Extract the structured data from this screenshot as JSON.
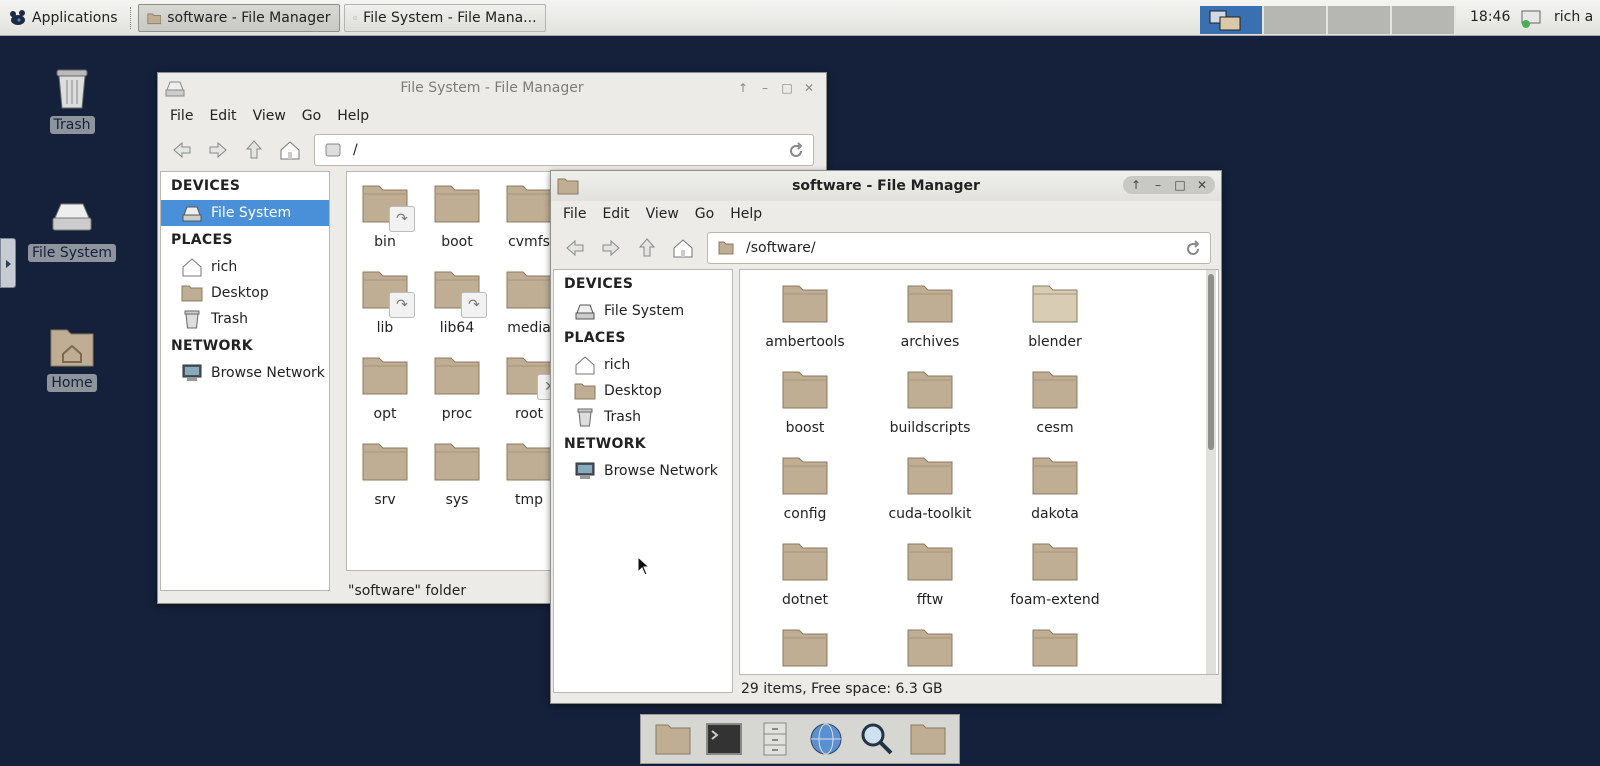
{
  "panel": {
    "apps_label": "Applications",
    "tasks": [
      {
        "label": "software - File Manager"
      },
      {
        "label": "File System - File Mana..."
      }
    ],
    "clock": "18:46",
    "user": "rich a"
  },
  "desktop": {
    "icons": [
      {
        "label": "Trash"
      },
      {
        "label": "File System"
      },
      {
        "label": "Home"
      }
    ]
  },
  "window_back": {
    "title": "File System - File Manager",
    "menu": [
      "File",
      "Edit",
      "View",
      "Go",
      "Help"
    ],
    "location": "/",
    "sidebar": {
      "devices_head": "DEVICES",
      "devices": [
        "File System"
      ],
      "places_head": "PLACES",
      "places": [
        "rich",
        "Desktop",
        "Trash"
      ],
      "network_head": "NETWORK",
      "network": [
        "Browse Network"
      ]
    },
    "folders": [
      "bin",
      "boot",
      "cvmfs",
      "lib",
      "lib64",
      "media",
      "opt",
      "proc",
      "root",
      "srv",
      "sys",
      "tmp"
    ],
    "status": "\"software\" folder"
  },
  "window_front": {
    "title": "software - File Manager",
    "menu": [
      "File",
      "Edit",
      "View",
      "Go",
      "Help"
    ],
    "location": "/software/",
    "sidebar": {
      "devices_head": "DEVICES",
      "devices": [
        "File System"
      ],
      "places_head": "PLACES",
      "places": [
        "rich",
        "Desktop",
        "Trash"
      ],
      "network_head": "NETWORK",
      "network": [
        "Browse Network"
      ]
    },
    "folders": [
      "ambertools",
      "archives",
      "blender",
      "boost",
      "buildscripts",
      "cesm",
      "config",
      "cuda-toolkit",
      "dakota",
      "dotnet",
      "fftw",
      "foam-extend",
      "",
      "",
      ""
    ],
    "status": "29 items, Free space: 6.3 GB"
  },
  "colors": {
    "desktop_bg": "#15213a",
    "selection": "#4a90d9",
    "folder": "#bfae93"
  }
}
